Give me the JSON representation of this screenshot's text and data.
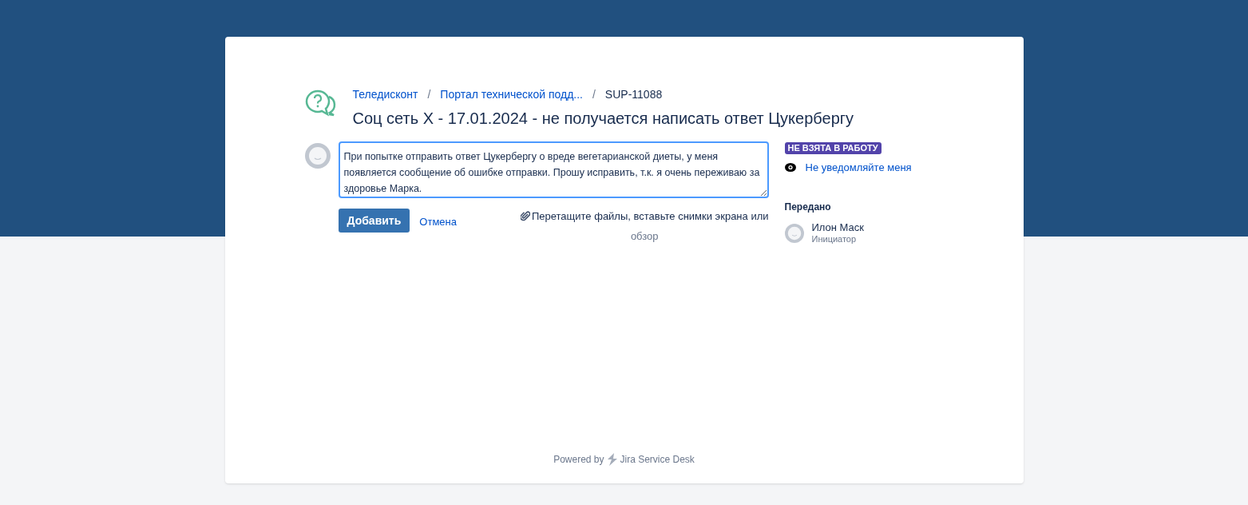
{
  "breadcrumbs": [
    {
      "label": "Теледисконт",
      "kind": "link"
    },
    {
      "label": "Портал технической подд...",
      "kind": "link"
    },
    {
      "label": "SUP-11088",
      "kind": "text"
    }
  ],
  "separator": "/",
  "title": "Соц сеть X - 17.01.2024 - не получается написать ответ Цукербергу",
  "comment": {
    "value": "При попытке отправить ответ Цукербергу о вреде вегетарианской диеты, у меня появляется сообщение об ошибке отправки. Прошу исправить, т.к. я очень переживаю за здоровье Марка.",
    "submit": "Добавить",
    "cancel": "Отмена",
    "attach_hint": "Перетащите файлы, вставьте снимки экрана или",
    "browse": "обзор"
  },
  "status": {
    "label": "НЕ ВЗЯТА В РАБОТУ",
    "color": "#5243aa"
  },
  "watch": "Не уведомляйте меня",
  "assigned": {
    "heading": "Передано",
    "name": "Илон Маск",
    "role": "Инициатор"
  },
  "footer": {
    "prefix": "Powered by",
    "product": "Jira Service Desk"
  }
}
